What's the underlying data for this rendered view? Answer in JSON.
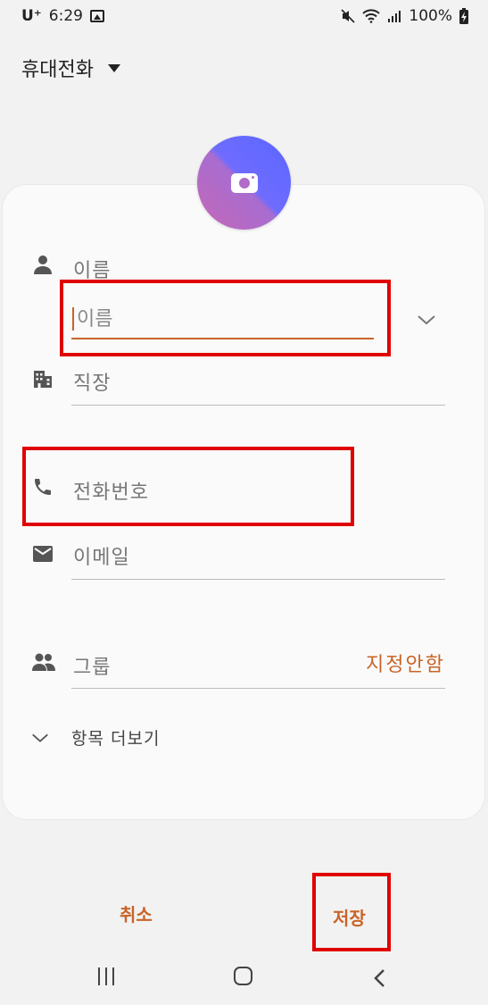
{
  "status_bar": {
    "carrier": "U⁺",
    "time": "6:29",
    "battery": "100%"
  },
  "account": {
    "label": "휴대전화"
  },
  "form": {
    "name_section_label": "이름",
    "name_input": {
      "value": "",
      "placeholder": "이름"
    },
    "company_label": "직장",
    "phone_label": "전화번호",
    "email_label": "이메일",
    "group_label": "그룹",
    "group_value": "지정안함",
    "more_fields_label": "항목 더보기"
  },
  "actions": {
    "cancel": "취소",
    "save": "저장"
  },
  "icons": {
    "person": "person-icon",
    "company": "building-icon",
    "phone": "phone-icon",
    "email": "mail-icon",
    "group": "group-icon",
    "expand": "chevron-down-icon",
    "camera": "camera-icon"
  },
  "colors": {
    "accent": "#c96428",
    "highlight": "#e00000",
    "avatar_start": "#c468b6",
    "avatar_end": "#5a66ff"
  }
}
